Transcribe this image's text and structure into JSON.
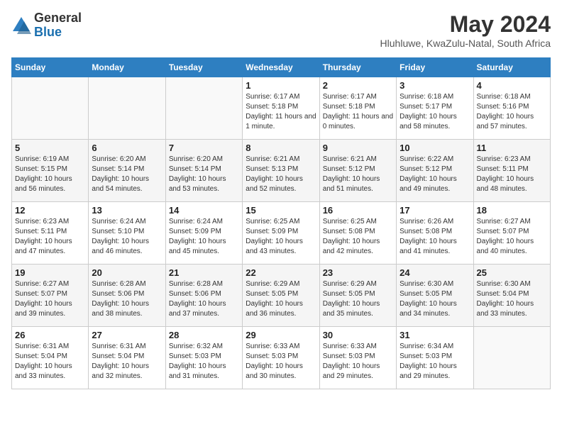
{
  "header": {
    "logo_general": "General",
    "logo_blue": "Blue",
    "month_year": "May 2024",
    "location": "Hluhluwe, KwaZulu-Natal, South Africa"
  },
  "weekdays": [
    "Sunday",
    "Monday",
    "Tuesday",
    "Wednesday",
    "Thursday",
    "Friday",
    "Saturday"
  ],
  "weeks": [
    [
      {
        "day": "",
        "info": ""
      },
      {
        "day": "",
        "info": ""
      },
      {
        "day": "",
        "info": ""
      },
      {
        "day": "1",
        "info": "Sunrise: 6:17 AM\nSunset: 5:18 PM\nDaylight: 11 hours\nand 1 minute."
      },
      {
        "day": "2",
        "info": "Sunrise: 6:17 AM\nSunset: 5:18 PM\nDaylight: 11 hours\nand 0 minutes."
      },
      {
        "day": "3",
        "info": "Sunrise: 6:18 AM\nSunset: 5:17 PM\nDaylight: 10 hours\nand 58 minutes."
      },
      {
        "day": "4",
        "info": "Sunrise: 6:18 AM\nSunset: 5:16 PM\nDaylight: 10 hours\nand 57 minutes."
      }
    ],
    [
      {
        "day": "5",
        "info": "Sunrise: 6:19 AM\nSunset: 5:15 PM\nDaylight: 10 hours\nand 56 minutes."
      },
      {
        "day": "6",
        "info": "Sunrise: 6:20 AM\nSunset: 5:14 PM\nDaylight: 10 hours\nand 54 minutes."
      },
      {
        "day": "7",
        "info": "Sunrise: 6:20 AM\nSunset: 5:14 PM\nDaylight: 10 hours\nand 53 minutes."
      },
      {
        "day": "8",
        "info": "Sunrise: 6:21 AM\nSunset: 5:13 PM\nDaylight: 10 hours\nand 52 minutes."
      },
      {
        "day": "9",
        "info": "Sunrise: 6:21 AM\nSunset: 5:12 PM\nDaylight: 10 hours\nand 51 minutes."
      },
      {
        "day": "10",
        "info": "Sunrise: 6:22 AM\nSunset: 5:12 PM\nDaylight: 10 hours\nand 49 minutes."
      },
      {
        "day": "11",
        "info": "Sunrise: 6:23 AM\nSunset: 5:11 PM\nDaylight: 10 hours\nand 48 minutes."
      }
    ],
    [
      {
        "day": "12",
        "info": "Sunrise: 6:23 AM\nSunset: 5:11 PM\nDaylight: 10 hours\nand 47 minutes."
      },
      {
        "day": "13",
        "info": "Sunrise: 6:24 AM\nSunset: 5:10 PM\nDaylight: 10 hours\nand 46 minutes."
      },
      {
        "day": "14",
        "info": "Sunrise: 6:24 AM\nSunset: 5:09 PM\nDaylight: 10 hours\nand 45 minutes."
      },
      {
        "day": "15",
        "info": "Sunrise: 6:25 AM\nSunset: 5:09 PM\nDaylight: 10 hours\nand 43 minutes."
      },
      {
        "day": "16",
        "info": "Sunrise: 6:25 AM\nSunset: 5:08 PM\nDaylight: 10 hours\nand 42 minutes."
      },
      {
        "day": "17",
        "info": "Sunrise: 6:26 AM\nSunset: 5:08 PM\nDaylight: 10 hours\nand 41 minutes."
      },
      {
        "day": "18",
        "info": "Sunrise: 6:27 AM\nSunset: 5:07 PM\nDaylight: 10 hours\nand 40 minutes."
      }
    ],
    [
      {
        "day": "19",
        "info": "Sunrise: 6:27 AM\nSunset: 5:07 PM\nDaylight: 10 hours\nand 39 minutes."
      },
      {
        "day": "20",
        "info": "Sunrise: 6:28 AM\nSunset: 5:06 PM\nDaylight: 10 hours\nand 38 minutes."
      },
      {
        "day": "21",
        "info": "Sunrise: 6:28 AM\nSunset: 5:06 PM\nDaylight: 10 hours\nand 37 minutes."
      },
      {
        "day": "22",
        "info": "Sunrise: 6:29 AM\nSunset: 5:05 PM\nDaylight: 10 hours\nand 36 minutes."
      },
      {
        "day": "23",
        "info": "Sunrise: 6:29 AM\nSunset: 5:05 PM\nDaylight: 10 hours\nand 35 minutes."
      },
      {
        "day": "24",
        "info": "Sunrise: 6:30 AM\nSunset: 5:05 PM\nDaylight: 10 hours\nand 34 minutes."
      },
      {
        "day": "25",
        "info": "Sunrise: 6:30 AM\nSunset: 5:04 PM\nDaylight: 10 hours\nand 33 minutes."
      }
    ],
    [
      {
        "day": "26",
        "info": "Sunrise: 6:31 AM\nSunset: 5:04 PM\nDaylight: 10 hours\nand 33 minutes."
      },
      {
        "day": "27",
        "info": "Sunrise: 6:31 AM\nSunset: 5:04 PM\nDaylight: 10 hours\nand 32 minutes."
      },
      {
        "day": "28",
        "info": "Sunrise: 6:32 AM\nSunset: 5:03 PM\nDaylight: 10 hours\nand 31 minutes."
      },
      {
        "day": "29",
        "info": "Sunrise: 6:33 AM\nSunset: 5:03 PM\nDaylight: 10 hours\nand 30 minutes."
      },
      {
        "day": "30",
        "info": "Sunrise: 6:33 AM\nSunset: 5:03 PM\nDaylight: 10 hours\nand 29 minutes."
      },
      {
        "day": "31",
        "info": "Sunrise: 6:34 AM\nSunset: 5:03 PM\nDaylight: 10 hours\nand 29 minutes."
      },
      {
        "day": "",
        "info": ""
      }
    ]
  ]
}
